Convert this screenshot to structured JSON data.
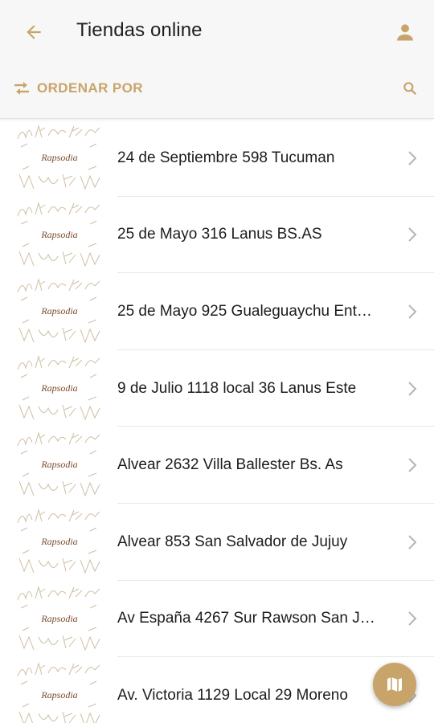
{
  "header": {
    "title": "Tiendas online",
    "back_icon": "arrow-back-icon",
    "user_icon": "person-icon"
  },
  "toolbar": {
    "sort_label": "ORDENAR POR",
    "sort_icon": "swap-arrows-icon",
    "search_icon": "search-icon"
  },
  "stores": [
    {
      "address": "24 de Septiembre 598 Tucuman",
      "logo_text": "Rapsodia"
    },
    {
      "address": "25 de Mayo 316 Lanus BS.AS",
      "logo_text": "Rapsodia"
    },
    {
      "address": "25 de Mayo 925 Gualeguaychu Ent…",
      "logo_text": "Rapsodia"
    },
    {
      "address": "9 de Julio 1118 local 36 Lanus Este",
      "logo_text": "Rapsodia"
    },
    {
      "address": "Alvear 2632 Villa Ballester Bs. As",
      "logo_text": "Rapsodia"
    },
    {
      "address": "Alvear 853 San Salvador de Jujuy",
      "logo_text": "Rapsodia"
    },
    {
      "address": "Av España 4267 Sur Rawson San J…",
      "logo_text": "Rapsodia"
    },
    {
      "address": "Av. Victoria 1129 Local 29 Moreno",
      "logo_text": "Rapsodia"
    }
  ],
  "fab": {
    "icon": "map-icon"
  },
  "colors": {
    "accent": "#c9a46a",
    "header_bg": "#f7f7f7",
    "divider": "#e6e6e6",
    "text": "#1c1c1c",
    "chevron": "#b5b5b5"
  }
}
